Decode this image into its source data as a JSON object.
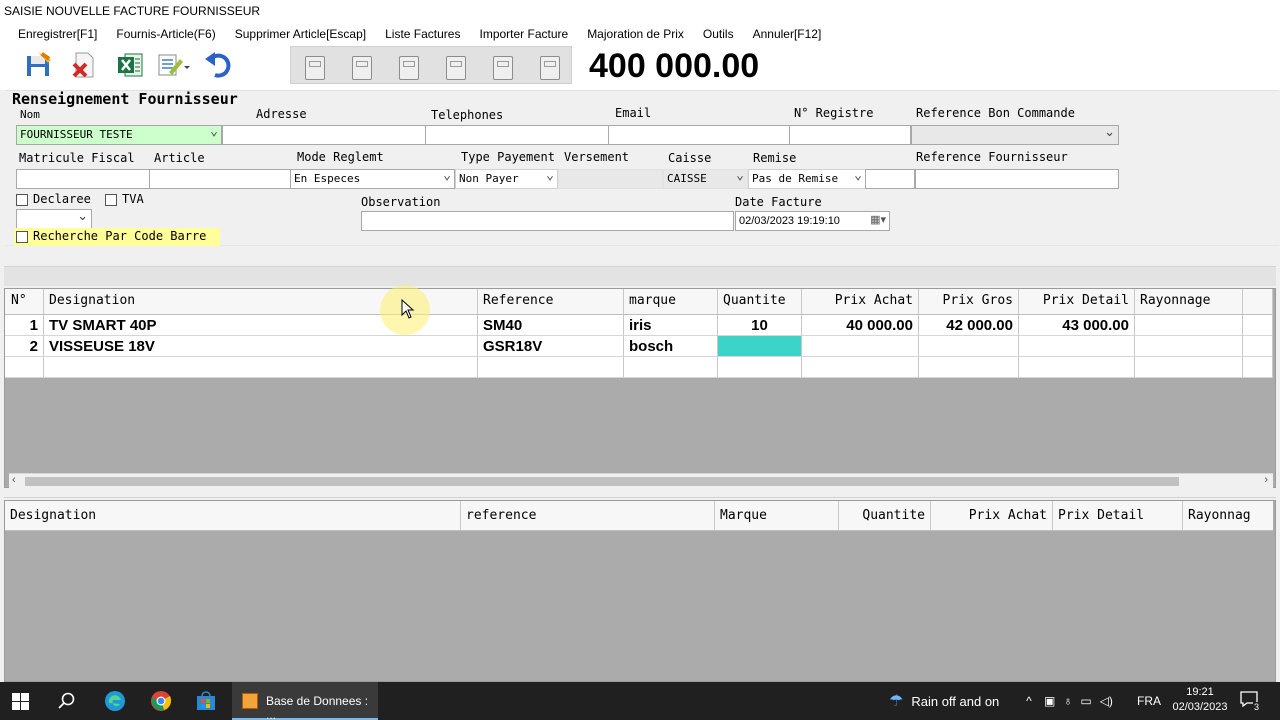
{
  "window": {
    "title": "SAISIE NOUVELLE FACTURE FOURNISSEUR"
  },
  "menu": [
    "Enregistrer[F1]",
    "Fournis-Article(F6)",
    "Supprimer Article[Escap]",
    "Liste Factures",
    "Importer Facture",
    "Majoration de Prix",
    "Outils",
    "Annuler[F12]"
  ],
  "toolbar": {
    "icons": [
      "save-icon",
      "delete-icon",
      "excel-icon",
      "list-edit-icon",
      "undo-icon"
    ],
    "total": "400 000.00"
  },
  "fournisseur": {
    "section_title": "Renseignement Fournisseur",
    "labels": {
      "nom": "Nom",
      "adresse": "Adresse",
      "telephones": "Telephones",
      "email": "Email",
      "registre": "N° Registre",
      "ref_bon": "Reference Bon Commande",
      "matricule": "Matricule Fiscal",
      "article": "Article",
      "mode_reglement": "Mode Reglemt",
      "type_payement": "Type Payement",
      "versement": "Versement",
      "caisse": "Caisse",
      "remise": "Remise",
      "ref_fournisseur": "Reference Fournisseur",
      "declaree": "Declaree",
      "tva": "TVA",
      "observation": "Observation",
      "date_facture": "Date Facture",
      "recherche_code_barre": "Recherche Par Code Barre"
    },
    "values": {
      "nom": "FOURNISSEUR TESTE",
      "mode_reglement": "En Especes",
      "type_payement": "Non Payer",
      "caisse": "CAISSE",
      "remise": "Pas de Remise",
      "date_facture": "02/03/2023 19:19:10"
    }
  },
  "grid_top": {
    "columns": [
      "N°",
      "Designation",
      "Reference",
      "marque",
      "Quantite",
      "Prix Achat",
      "Prix Gros",
      "Prix Detail",
      "Rayonnage"
    ],
    "rows": [
      {
        "n": "1",
        "designation": "TV SMART 40P",
        "reference": "SM40",
        "marque": "iris",
        "quantite": "10",
        "prix_achat": "40 000.00",
        "prix_gros": "42 000.00",
        "prix_detail": "43 000.00",
        "rayonnage": ""
      },
      {
        "n": "2",
        "designation": "VISSEUSE 18V",
        "reference": "GSR18V",
        "marque": "bosch",
        "quantite": "",
        "prix_achat": "",
        "prix_gros": "",
        "prix_detail": "",
        "rayonnage": ""
      }
    ]
  },
  "grid_bottom": {
    "columns": [
      "Designation",
      "reference",
      "Marque",
      "Quantite",
      "Prix Achat",
      "Prix Detail",
      "Rayonnag"
    ]
  },
  "taskbar": {
    "app_label": "Base de Donnees : ...",
    "weather": "Rain off and on",
    "lang": "FRA",
    "time": "19:21",
    "date": "02/03/2023",
    "notif_count": "3"
  },
  "colors": {
    "nom_field_bg": "#ccffcc",
    "recherche_bg": "#ffff99",
    "active_cell_bg": "#3cd3c8",
    "taskbar_bg": "#202020"
  }
}
